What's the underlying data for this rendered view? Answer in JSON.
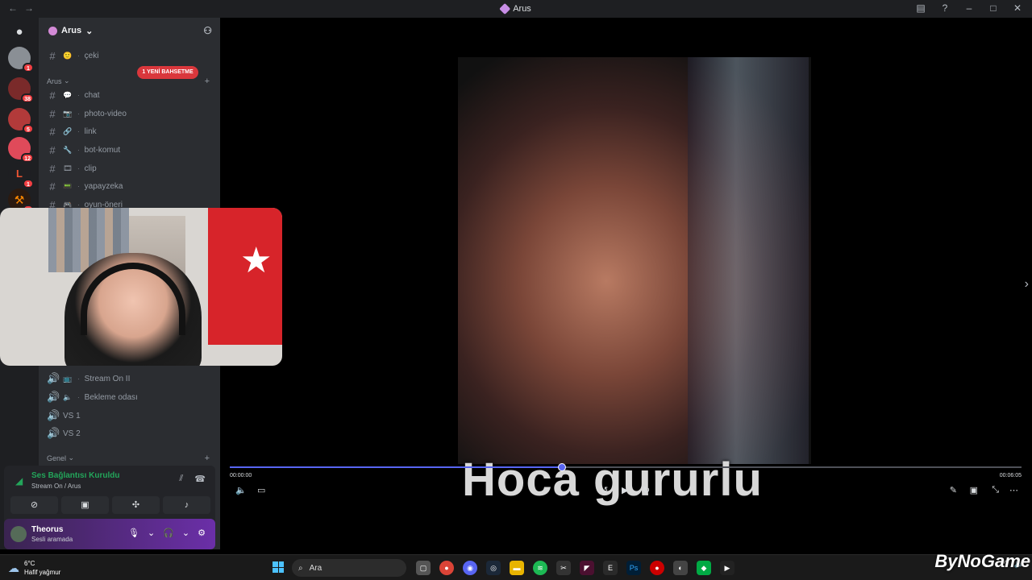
{
  "window": {
    "title": "Arus"
  },
  "guild": {
    "name": "Arus"
  },
  "server_badges": [
    "1",
    "38",
    "5",
    "12",
    "1",
    "4"
  ],
  "new_mention": "1 YENİ BAHSETME",
  "channels_top": [
    {
      "name": "çeki",
      "emoji": ""
    }
  ],
  "category_arus": "Arus",
  "text_channels": [
    {
      "name": "chat"
    },
    {
      "name": "photo-video"
    },
    {
      "name": "link"
    },
    {
      "name": "bot-komut"
    },
    {
      "name": "clip"
    },
    {
      "name": "yapayzeka"
    },
    {
      "name": "oyun-öneri"
    }
  ],
  "voice_channels": [
    {
      "name": "Stream On II"
    },
    {
      "name": "Bekleme odası"
    },
    {
      "name": "VS 1"
    },
    {
      "name": "VS 2"
    }
  ],
  "category_genel": "Genel",
  "voice_connection": {
    "status": "Ses Bağlantısı Kuruldu",
    "location": "Stream On / Arus"
  },
  "user": {
    "name": "Theorus",
    "status": "Sesli aramada"
  },
  "media": {
    "caption": "Hoca gururlu",
    "current_time": "00:00:00",
    "total_time": "00:06:05",
    "progress_fraction": 0.42
  },
  "taskbar": {
    "temperature": "6°C",
    "weather": "Hafif yağmur",
    "search_placeholder": "Ara"
  },
  "watermark": "ByNoGame"
}
